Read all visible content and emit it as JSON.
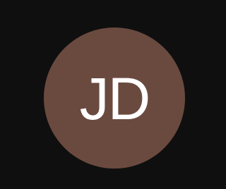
{
  "channel": {
    "avatar_initials": "JD",
    "avatar_color": "#6a4a3f"
  },
  "icons": {
    "avatar": "user-avatar"
  }
}
